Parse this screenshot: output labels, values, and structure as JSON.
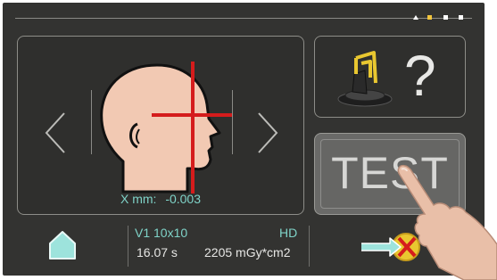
{
  "status_indicators": [
    {
      "icon": "triangle-indicator-icon",
      "active": false
    },
    {
      "icon": "square-indicator-icon",
      "active": true
    },
    {
      "icon": "square-indicator-icon",
      "active": false
    },
    {
      "icon": "square-indicator-icon",
      "active": false
    }
  ],
  "position_panel": {
    "x_label": "X mm:",
    "x_value": "-0.003",
    "left_icon": "chevron-left-icon",
    "right_icon": "chevron-right-icon",
    "patient_icon": "patient-head-profile-icon"
  },
  "help_button": {
    "label": "?",
    "icon": "device-help-icon"
  },
  "test_button": {
    "label": "TEST"
  },
  "exposure": {
    "program": "V1 10x10",
    "mode": "HD",
    "time": "16.07 s",
    "dose": "2205 mGy*cm2"
  },
  "colors": {
    "accent": "#7fd3c8",
    "active_indicator": "#f2c53d",
    "crosshair": "#d51c1c",
    "face": "#f2c9b3"
  }
}
